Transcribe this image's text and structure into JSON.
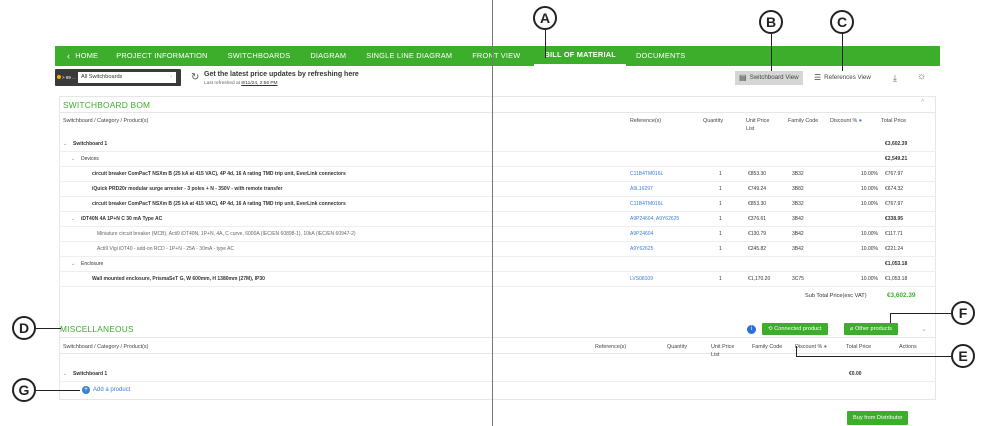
{
  "callouts": {
    "a": "A",
    "b": "B",
    "c": "C",
    "d": "D",
    "e": "E",
    "f": "F",
    "g": "G"
  },
  "nav": {
    "home": "HOME",
    "items": [
      "PROJECT INFORMATION",
      "SWITCHBOARDS",
      "DIAGRAM",
      "SINGLE LINE DIAGRAM",
      "FRONT VIEW",
      "BILL OF MATERIAL",
      "DOCUMENTS"
    ],
    "active": "BILL OF MATERIAL",
    "color": "#3dae2b"
  },
  "selector": {
    "tag": "> 99 ... ",
    "value": "All Switchboards"
  },
  "refresh": {
    "title": "Get the latest price updates by refreshing here",
    "sub_prefix": "Last refreshed at ",
    "timestamp": "8/11/24, 2:56 PM"
  },
  "views": {
    "switchboard": "Switchboard View",
    "references": "References View"
  },
  "bom": {
    "title": "SWITCHBOARD BOM",
    "headers": {
      "product": "Switchboard / Category / Product(s)",
      "reference": "Reference(s)",
      "quantity": "Quantity",
      "unit_price": "Unit Price List",
      "family": "Family Code",
      "discount": "Discount %",
      "total": "Total Price"
    },
    "rows": [
      {
        "label": "Switchboard 1",
        "ref": "",
        "qty": "",
        "unit": "",
        "fam": "",
        "disc": "",
        "total": "€3,602.39"
      },
      {
        "label": "Devices",
        "ref": "",
        "qty": "",
        "unit": "",
        "fam": "",
        "disc": "",
        "total": "€2,549.21"
      },
      {
        "label": "circuit breaker ComPacT NSXm B (25 kA at 415 VAC), 4P 4d, 16 A rating TMD trip unit, EverLink connectors",
        "ref": "C11B4TM016L",
        "qty": "1",
        "unit": "€853.30",
        "fam": "3B32",
        "disc": "10.00%",
        "total": "€767.97"
      },
      {
        "label": "iQuick PRD20r modular surge arrester - 3 poles + N - 350V - with remote transfer",
        "ref": "A9L16297",
        "qty": "1",
        "unit": "€749.24",
        "fam": "3B82",
        "disc": "10.00%",
        "total": "€674.32"
      },
      {
        "label": "circuit breaker ComPacT NSXm B (25 kA at 415 VAC), 4P 4d, 16 A rating TMD trip unit, EverLink connectors",
        "ref": "C11B4TM016L",
        "qty": "1",
        "unit": "€853.30",
        "fam": "3B32",
        "disc": "10.00%",
        "total": "€767.97"
      },
      {
        "label": "iDT40N 4A 1P+N C 30 mA Type AC",
        "ref": "A9P24604, A9Y62625",
        "qty": "1",
        "unit": "€376.61",
        "fam": "3B42",
        "disc": "",
        "total": "€338.95"
      },
      {
        "label": "Miniature circuit breaker (MCB), Acti9 iDT40N, 1P+N, 4A, C curve, 6000A (IEC/EN 60898-1), 10kA (IEC/EN 60947-2)",
        "ref": "A9P24604",
        "qty": "1",
        "unit": "€130.79",
        "fam": "3B42",
        "disc": "10.00%",
        "total": "€117.71"
      },
      {
        "label": "Acti9 Vigi iDT40 - add-on RCD - 1P+N - 25A - 30mA - type AC",
        "ref": "A9Y62625",
        "qty": "1",
        "unit": "€245.82",
        "fam": "3B42",
        "disc": "10.00%",
        "total": "€221.24"
      },
      {
        "label": "Enclosure",
        "ref": "",
        "qty": "",
        "unit": "",
        "fam": "",
        "disc": "",
        "total": "€1,053.18"
      },
      {
        "label": "Wall mounted enclosure, PrismaSeT G, W 600mm, H 1380mm (27M), IP30",
        "ref": "LVS08109",
        "qty": "1",
        "unit": "€1,170.20",
        "fam": "3C75",
        "disc": "10.00%",
        "total": "€1,053.18"
      }
    ],
    "subtotal_label": "Sub Total Price(exc VAT)",
    "subtotal_value": "€3,602.39"
  },
  "misc": {
    "title": "MISCELLANEOUS",
    "connected": "Connected product",
    "other": "Other products",
    "headers": {
      "product": "Switchboard / Category / Product(s)",
      "reference": "Reference(s)",
      "quantity": "Quantity",
      "unit_price": "Unit Price List",
      "family": "Family Code",
      "discount": "Discount %",
      "total": "Total Price",
      "actions": "Actions"
    },
    "row_label": "Switchboard 1",
    "row_total": "€0.00",
    "add_product": "Add a product"
  },
  "buy_button": "Buy from Distributor"
}
